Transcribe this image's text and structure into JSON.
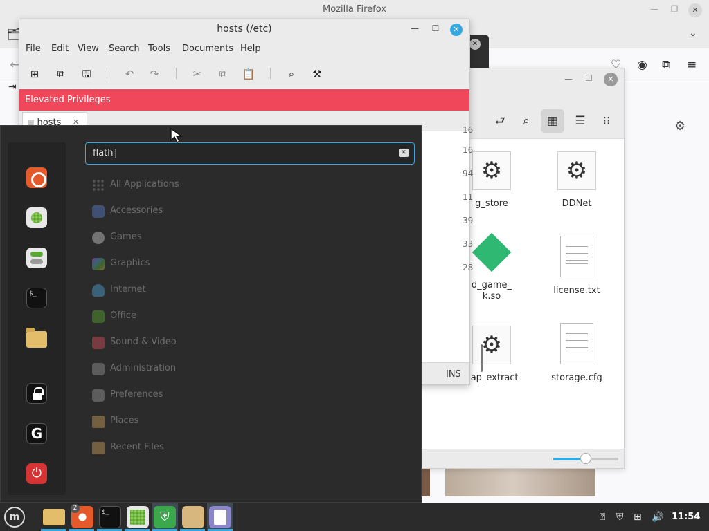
{
  "firefox": {
    "title": "Mozilla Firefox"
  },
  "gedit": {
    "title": "hosts (/etc)",
    "menu": [
      "File",
      "Edit",
      "View",
      "Search",
      "Tools",
      "Documents",
      "Help"
    ],
    "banner": "Elevated Privileges",
    "tab_label": "hosts",
    "line_numbers": [
      "16",
      "16",
      "94",
      "11",
      "39",
      "33",
      "28"
    ],
    "status_mode": "INS"
  },
  "file_manager": {
    "items": [
      {
        "label": "g_store",
        "icon": "gear-icon"
      },
      {
        "label": "DDNet",
        "icon": "gear-icon"
      },
      {
        "label": "d_game_\nk.so",
        "icon": "library-icon"
      },
      {
        "label": "license.txt",
        "icon": "text-file-icon"
      },
      {
        "label": "nap_extract",
        "icon": "gear-icon"
      },
      {
        "label": "storage.cfg",
        "icon": "text-file-icon"
      }
    ],
    "zoom_level_fraction": 0.5
  },
  "menu": {
    "search_value": "flath",
    "categories": [
      {
        "label": "All Applications",
        "icon": "grid-icon",
        "color": "#888888"
      },
      {
        "label": "Accessories",
        "icon": "accessories-icon",
        "color": "#5b7fd1"
      },
      {
        "label": "Games",
        "icon": "gamepad-icon",
        "color": "#cccccc"
      },
      {
        "label": "Graphics",
        "icon": "graphics-icon",
        "color": "#c94fd6"
      },
      {
        "label": "Internet",
        "icon": "cloud-icon",
        "color": "#4fa3d6"
      },
      {
        "label": "Office",
        "icon": "office-icon",
        "color": "#5aa832"
      },
      {
        "label": "Sound & Video",
        "icon": "media-icon",
        "color": "#d64f5b"
      },
      {
        "label": "Administration",
        "icon": "admin-icon",
        "color": "#999999"
      },
      {
        "label": "Preferences",
        "icon": "preferences-icon",
        "color": "#999999"
      },
      {
        "label": "Places",
        "icon": "folder-icon",
        "color": "#c9a15a"
      },
      {
        "label": "Recent Files",
        "icon": "recent-folder-icon",
        "color": "#c9a15a"
      }
    ]
  },
  "taskbar": {
    "firefox_badge": "2",
    "clock": "11:54"
  },
  "colors": {
    "accent": "#35a8e0",
    "banner": "#f0485a",
    "mint_green": "#5aa832"
  }
}
